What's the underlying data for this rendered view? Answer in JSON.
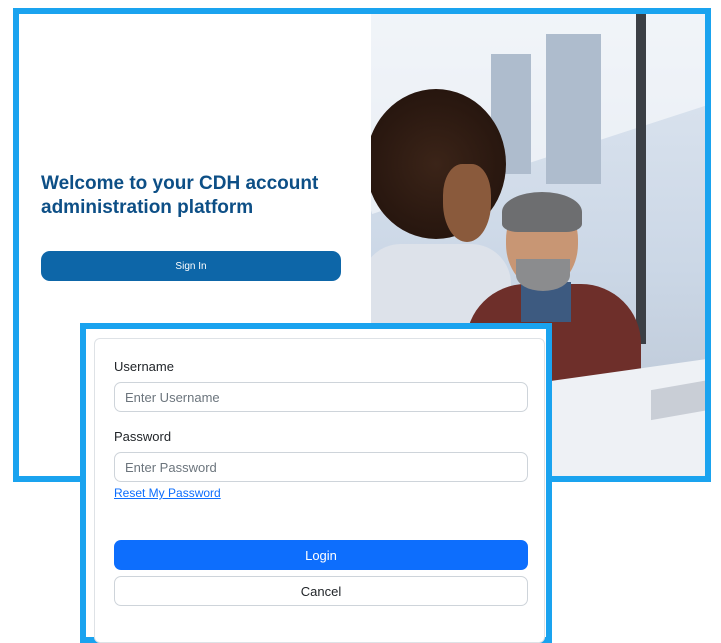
{
  "welcome": {
    "title": "Welcome to your CDH account administration platform",
    "sign_in_label": "Sign In"
  },
  "login": {
    "username_label": "Username",
    "username_placeholder": "Enter Username",
    "password_label": "Password",
    "password_placeholder": "Enter Password",
    "reset_link": "Reset My Password",
    "login_label": "Login",
    "cancel_label": "Cancel"
  },
  "colors": {
    "frame_highlight": "#1aa3ef",
    "welcome_title": "#0d4f86",
    "sign_in_button": "#0d66a8",
    "login_button": "#0d6efd"
  }
}
